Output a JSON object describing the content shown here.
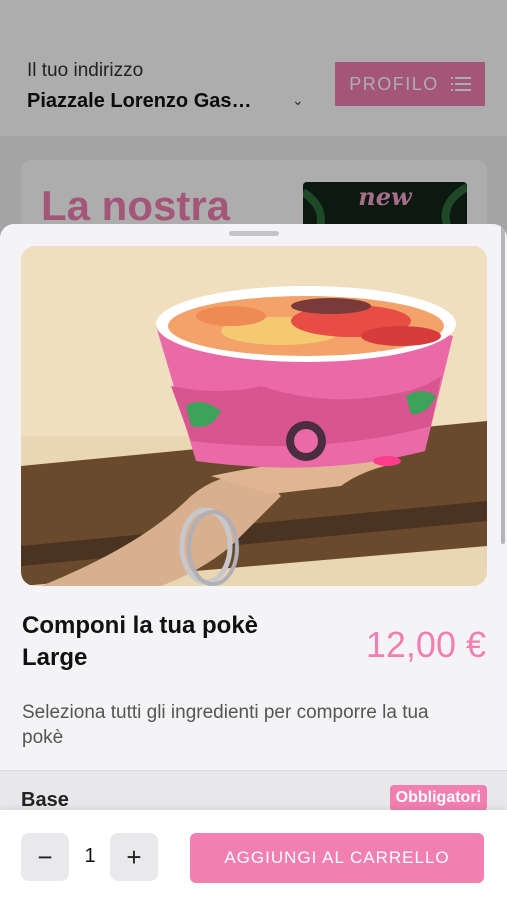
{
  "background": {
    "address_label": "Il tuo indirizzo",
    "address_value": "Piazzale Lorenzo Gas…",
    "profile_label": "PROFILO",
    "promo_title": "La nostra",
    "promo_badge": "new"
  },
  "product": {
    "name_line1": "Componi la tua pokè",
    "name_line2": "Large",
    "price": "12,00 €",
    "description": "Seleziona tutti gli ingredienti per comporre la tua pokè"
  },
  "section": {
    "title": "Base",
    "badge": "Obbligatori"
  },
  "footer": {
    "minus": "−",
    "plus": "+",
    "quantity": "1",
    "add_to_cart": "AGGIUNGI AL CARRELLO"
  },
  "colors": {
    "accent": "#f27fb2",
    "sheet_bg": "#f4f4f6"
  },
  "icons": {
    "profile_menu": "list-icon",
    "address_dropdown": "chevron-down-icon"
  }
}
